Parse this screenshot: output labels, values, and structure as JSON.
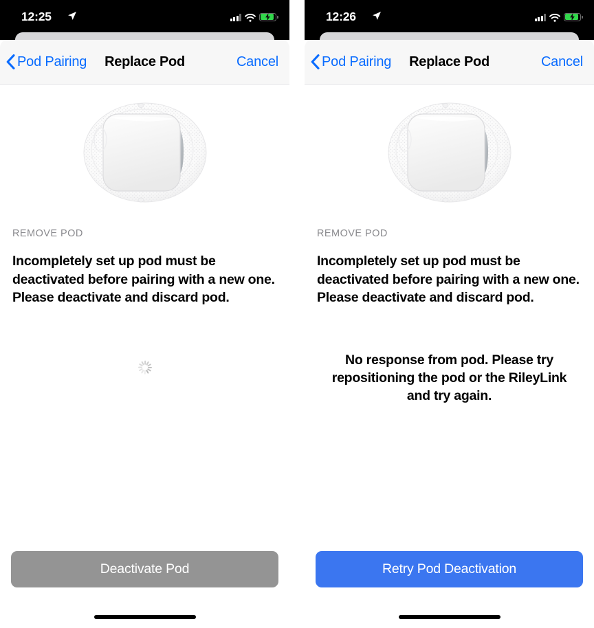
{
  "panels": [
    {
      "status": {
        "time": "12:25",
        "location_icon": "location-arrow-icon",
        "signal_icon": "cellular-bars-icon",
        "wifi_icon": "wifi-icon",
        "battery_icon": "battery-charging-icon"
      },
      "nav": {
        "back_label": "Pod Pairing",
        "back_icon": "chevron-left-icon",
        "title": "Replace Pod",
        "cancel_label": "Cancel"
      },
      "image": {
        "name": "insulin-pod-image",
        "alt": "Omnipod insulin pod on adhesive pad"
      },
      "section_label": "REMOVE POD",
      "body_text": "Incompletely set up pod must be deactivated before pairing with a new one. Please deactivate and discard pod.",
      "spinner": {
        "visible": true,
        "name": "activity-indicator"
      },
      "error_text": "",
      "button": {
        "label": "Deactivate Pod",
        "state": "disabled",
        "color": "#949494"
      }
    },
    {
      "status": {
        "time": "12:26",
        "location_icon": "location-arrow-icon",
        "signal_icon": "cellular-bars-icon",
        "wifi_icon": "wifi-icon",
        "battery_icon": "battery-charging-icon"
      },
      "nav": {
        "back_label": "Pod Pairing",
        "back_icon": "chevron-left-icon",
        "title": "Replace Pod",
        "cancel_label": "Cancel"
      },
      "image": {
        "name": "insulin-pod-image",
        "alt": "Omnipod insulin pod on adhesive pad"
      },
      "section_label": "REMOVE POD",
      "body_text": "Incompletely set up pod must be deactivated before pairing with a new one. Please deactivate and discard pod.",
      "spinner": {
        "visible": false,
        "name": "activity-indicator"
      },
      "error_text": "No response from pod. Please try repositioning the pod or the RileyLink and try again.",
      "button": {
        "label": "Retry Pod Deactivation",
        "state": "enabled",
        "color": "#3B76F0"
      }
    }
  ],
  "theme": {
    "accent_blue": "#0A6CFF",
    "primary_button_blue": "#3B76F0",
    "disabled_gray": "#949494",
    "navbar_bg": "#F7F7F7",
    "section_label_gray": "#8A8A8E",
    "battery_green": "#32D74B"
  }
}
